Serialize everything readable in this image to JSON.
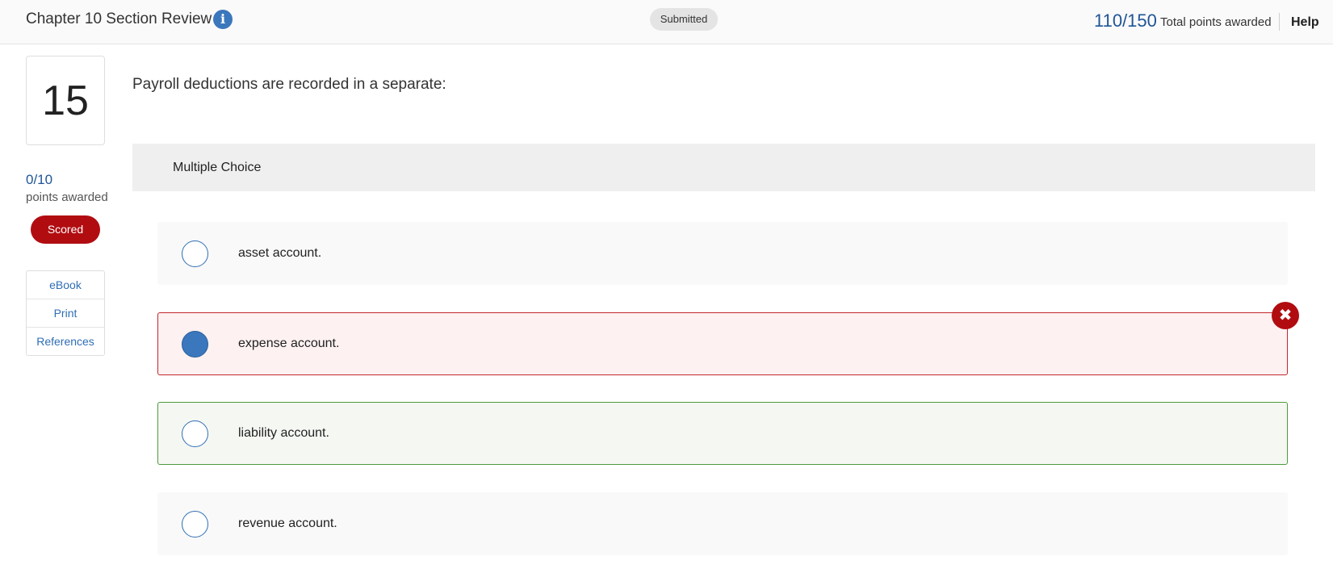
{
  "header": {
    "title": "Chapter 10 Section Review",
    "info_icon": "info-icon",
    "status": "Submitted",
    "total_score": "110/150",
    "total_label": "Total points awarded",
    "help": "Help"
  },
  "sidebar": {
    "question_number": "15",
    "points": "0/10",
    "points_label": "points awarded",
    "scored_badge": "Scored",
    "tools": [
      "eBook",
      "Print",
      "References"
    ]
  },
  "question": {
    "prompt": "Payroll deductions are recorded in a separate:",
    "type": "Multiple Choice",
    "options": [
      {
        "text": "asset account.",
        "state": "default"
      },
      {
        "text": "expense account.",
        "state": "selected-incorrect"
      },
      {
        "text": "liability account.",
        "state": "correct"
      },
      {
        "text": "revenue account.",
        "state": "default"
      }
    ],
    "incorrect_icon": "close-icon"
  },
  "colors": {
    "accent_blue": "#3b77bc",
    "score_blue": "#1f5597",
    "incorrect_red": "#b10d11",
    "correct_green": "#4d9a3d"
  }
}
